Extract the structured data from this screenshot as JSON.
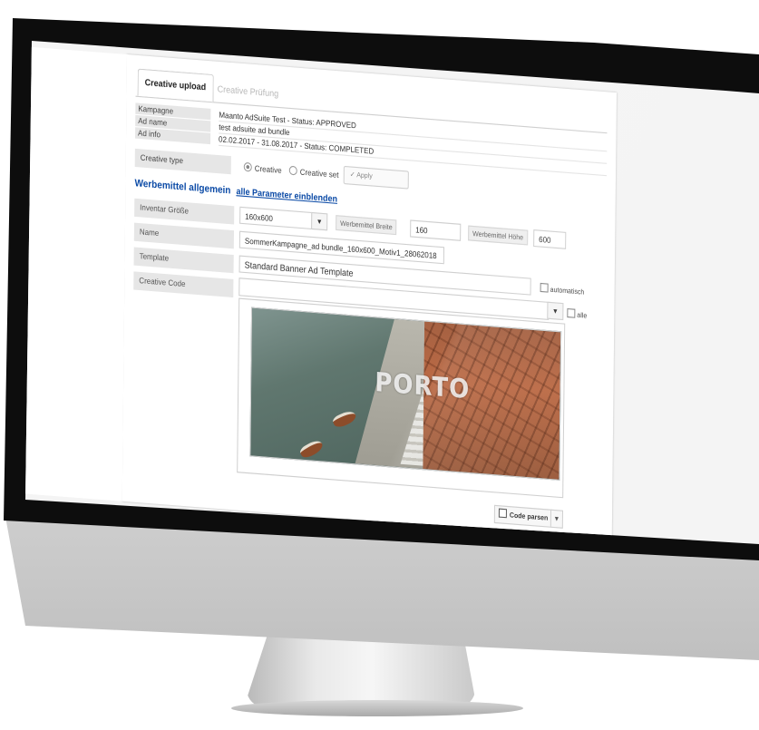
{
  "tabs": [
    {
      "label": "Creative upload",
      "active": true
    },
    {
      "label": "Creative Prüfung",
      "active": false
    }
  ],
  "campaign_info": [
    {
      "label": "Kampagne",
      "value": "Maanto AdSuite Test - Status: APPROVED"
    },
    {
      "label": "Ad name",
      "value": "test adsuite ad bundle"
    },
    {
      "label": "Ad info",
      "value": "02.02.2017 - 31.08.2017 - Status: COMPLETED"
    }
  ],
  "creative_type": {
    "label": "Creative type",
    "options": [
      {
        "label": "Creative",
        "selected": true
      },
      {
        "label": "Creative set",
        "selected": false
      }
    ],
    "apply_label": "Apply"
  },
  "section": {
    "title": "Werbemittel allgemein",
    "link": "alle Parameter einblenden"
  },
  "form": {
    "inventory_size": {
      "label": "Inventar Größe",
      "value": "160x600"
    },
    "width": {
      "label": "Werbemittel Breite",
      "value": "160"
    },
    "height": {
      "label": "Werbemittel Höhe",
      "value": "600"
    },
    "name": {
      "label": "Name",
      "value": "SommerKampagne_ad bundle_160x600_Motiv1_28062018"
    },
    "template": {
      "label": "Template",
      "value": "Standard Banner Ad Template"
    },
    "automatic_label": "automatisch",
    "creative_code": {
      "label": "Creative Code"
    },
    "all_label": "alle"
  },
  "banner": {
    "text": "PORTO"
  },
  "actions": {
    "parse_label": "Code parsen"
  }
}
